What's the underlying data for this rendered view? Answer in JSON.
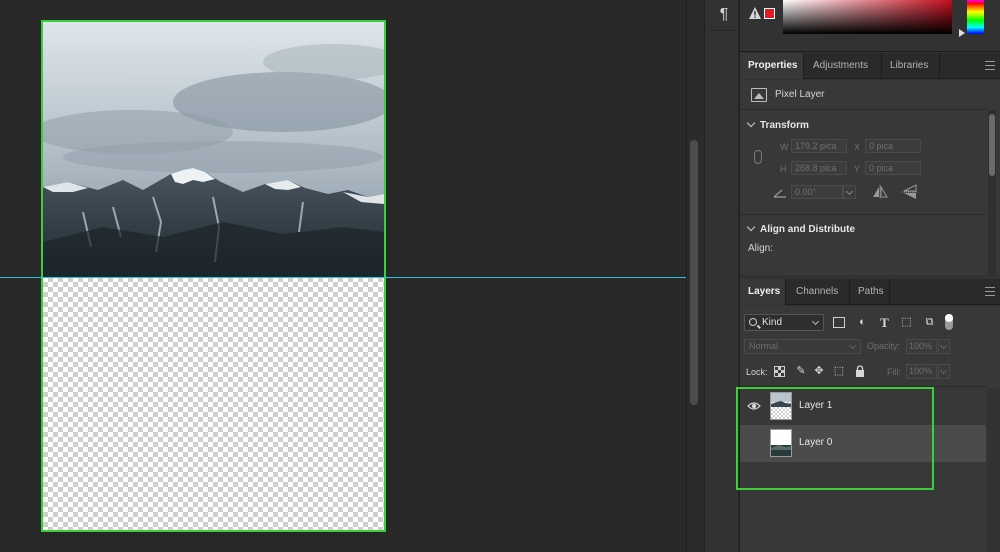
{
  "document": {
    "image_description": "",
    "guide_color": "#2fc3d8",
    "selection_color": "#3ccf3c"
  },
  "colors": {
    "gamut_warning": "#e01b22",
    "foreground_hue": "#c40d1e"
  },
  "properties_panel": {
    "tabs": [
      "Properties",
      "Adjustments",
      "Libraries"
    ],
    "active_tab": "Properties",
    "layer_type": "Pixel Layer",
    "transform": {
      "heading": "Transform",
      "w_label": "W",
      "w_value": "179.2 pica",
      "h_label": "H",
      "h_value": "268.8 pica",
      "x_label": "X",
      "x_value": "0 pica",
      "y_label": "Y",
      "y_value": "0 pica",
      "angle_value": "0.00°"
    },
    "align": {
      "heading": "Align and Distribute",
      "label": "Align:"
    }
  },
  "layers_panel": {
    "tabs": [
      "Layers",
      "Channels",
      "Paths"
    ],
    "active_tab": "Layers",
    "filter_kind": "Kind",
    "blend_mode": "Normal",
    "opacity_label": "Opacity:",
    "opacity_value": "100%",
    "lock_label": "Lock:",
    "fill_label": "Fill:",
    "fill_value": "100%",
    "layers": [
      {
        "name": "Layer 1",
        "visible": true,
        "selected": false
      },
      {
        "name": "Layer 0",
        "visible": false,
        "selected": true
      }
    ]
  },
  "icons": {
    "paragraph": "¶",
    "adjustment": "◐",
    "type": "T",
    "shape": "⬚",
    "smart": "⧉",
    "paint": "✎",
    "move": "✥",
    "artboard": "⬚",
    "lock": "🔒"
  }
}
